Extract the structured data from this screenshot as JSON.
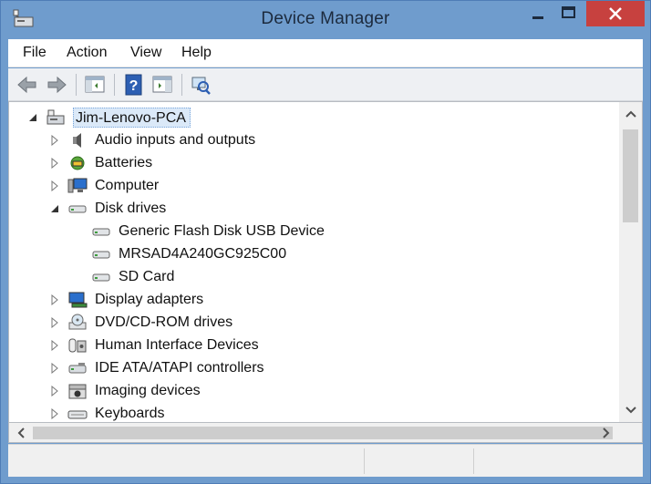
{
  "window": {
    "title": "Device Manager"
  },
  "menu": {
    "items": [
      "File",
      "Action",
      "View",
      "Help"
    ]
  },
  "tree": {
    "root": "Jim-Lenovo-PCA",
    "nodes": [
      {
        "label": "Audio inputs and outputs",
        "icon": "speaker-icon",
        "expanded": false
      },
      {
        "label": "Batteries",
        "icon": "battery-icon",
        "expanded": false
      },
      {
        "label": "Computer",
        "icon": "computer-icon",
        "expanded": false
      },
      {
        "label": "Disk drives",
        "icon": "disk-drive-icon",
        "expanded": true,
        "children": [
          "Generic Flash Disk USB Device",
          "MRSAD4A240GC925C00",
          "SD Card"
        ]
      },
      {
        "label": "Display adapters",
        "icon": "display-adapter-icon",
        "expanded": false
      },
      {
        "label": "DVD/CD-ROM drives",
        "icon": "dvd-drive-icon",
        "expanded": false
      },
      {
        "label": "Human Interface Devices",
        "icon": "hid-icon",
        "expanded": false
      },
      {
        "label": "IDE ATA/ATAPI controllers",
        "icon": "ide-controller-icon",
        "expanded": false
      },
      {
        "label": "Imaging devices",
        "icon": "camera-icon",
        "expanded": false
      },
      {
        "label": "Keyboards",
        "icon": "keyboard-icon",
        "expanded": false
      }
    ]
  },
  "colors": {
    "titlebar": "#6f9ccd",
    "close_button": "#c7413f",
    "selection": "#dbe9f8"
  }
}
